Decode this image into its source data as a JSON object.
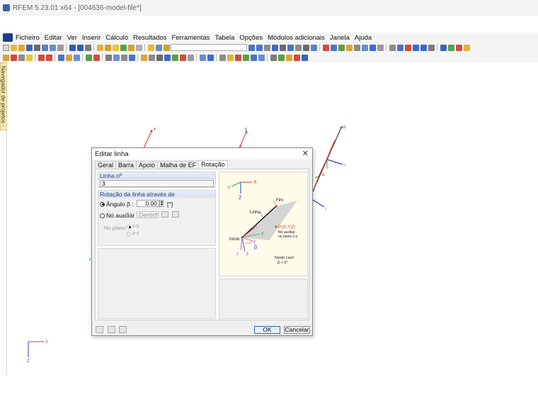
{
  "window": {
    "title": "RFEM 5.23.01 x64 - [004636-model-file*]"
  },
  "menu": [
    "Ficheiro",
    "Editar",
    "Ver",
    "Inserir",
    "Cálculo",
    "Resultados",
    "Ferramentas",
    "Tabela",
    "Opções",
    "Módulos adicionais",
    "Janela",
    "Ajuda"
  ],
  "sidebar": {
    "label": "Navegador de projetos - Mostrar"
  },
  "viewport": {
    "node_labels": [
      "4",
      "6",
      "12",
      "11"
    ],
    "axis_x": "X",
    "axis_z": "Z",
    "axis_y": "Y"
  },
  "dialog": {
    "title": "Editar linha",
    "tabs": [
      "Geral",
      "Barra",
      "Apoio",
      "Malha de EF",
      "Rotação"
    ],
    "line_group": {
      "header": "Linha nº",
      "value": "3"
    },
    "rotation_group": {
      "header": "Rotação da linha através de",
      "angle_label": "Ângulo",
      "beta_label": "β :",
      "angle_value": "0.00",
      "angle_unit": "[°]",
      "aux_node_label": "Nó auxiliar",
      "node_no_label": "Nº",
      "node_select": "Dentro",
      "plane_label": "No plano:",
      "plane_xy": "x-y",
      "plane_xz": "x-z"
    },
    "diagram": {
      "axis_x": "X",
      "axis_y": "Y",
      "axis_z": "Z",
      "fim": "Fim",
      "linha": "Linha",
      "inicio": "Início",
      "p_label": "P (X,Y,Z)",
      "aux_text_1": "Nó auxiliar",
      "aux_text_2": "no plano x-y",
      "note_1": "Neste caso",
      "note_2": "β < 0°",
      "x_loc": "x",
      "y_loc": "y",
      "z_loc": "z",
      "beta": "β"
    },
    "buttons": {
      "ok": "OK",
      "cancel": "Cancelar"
    }
  }
}
